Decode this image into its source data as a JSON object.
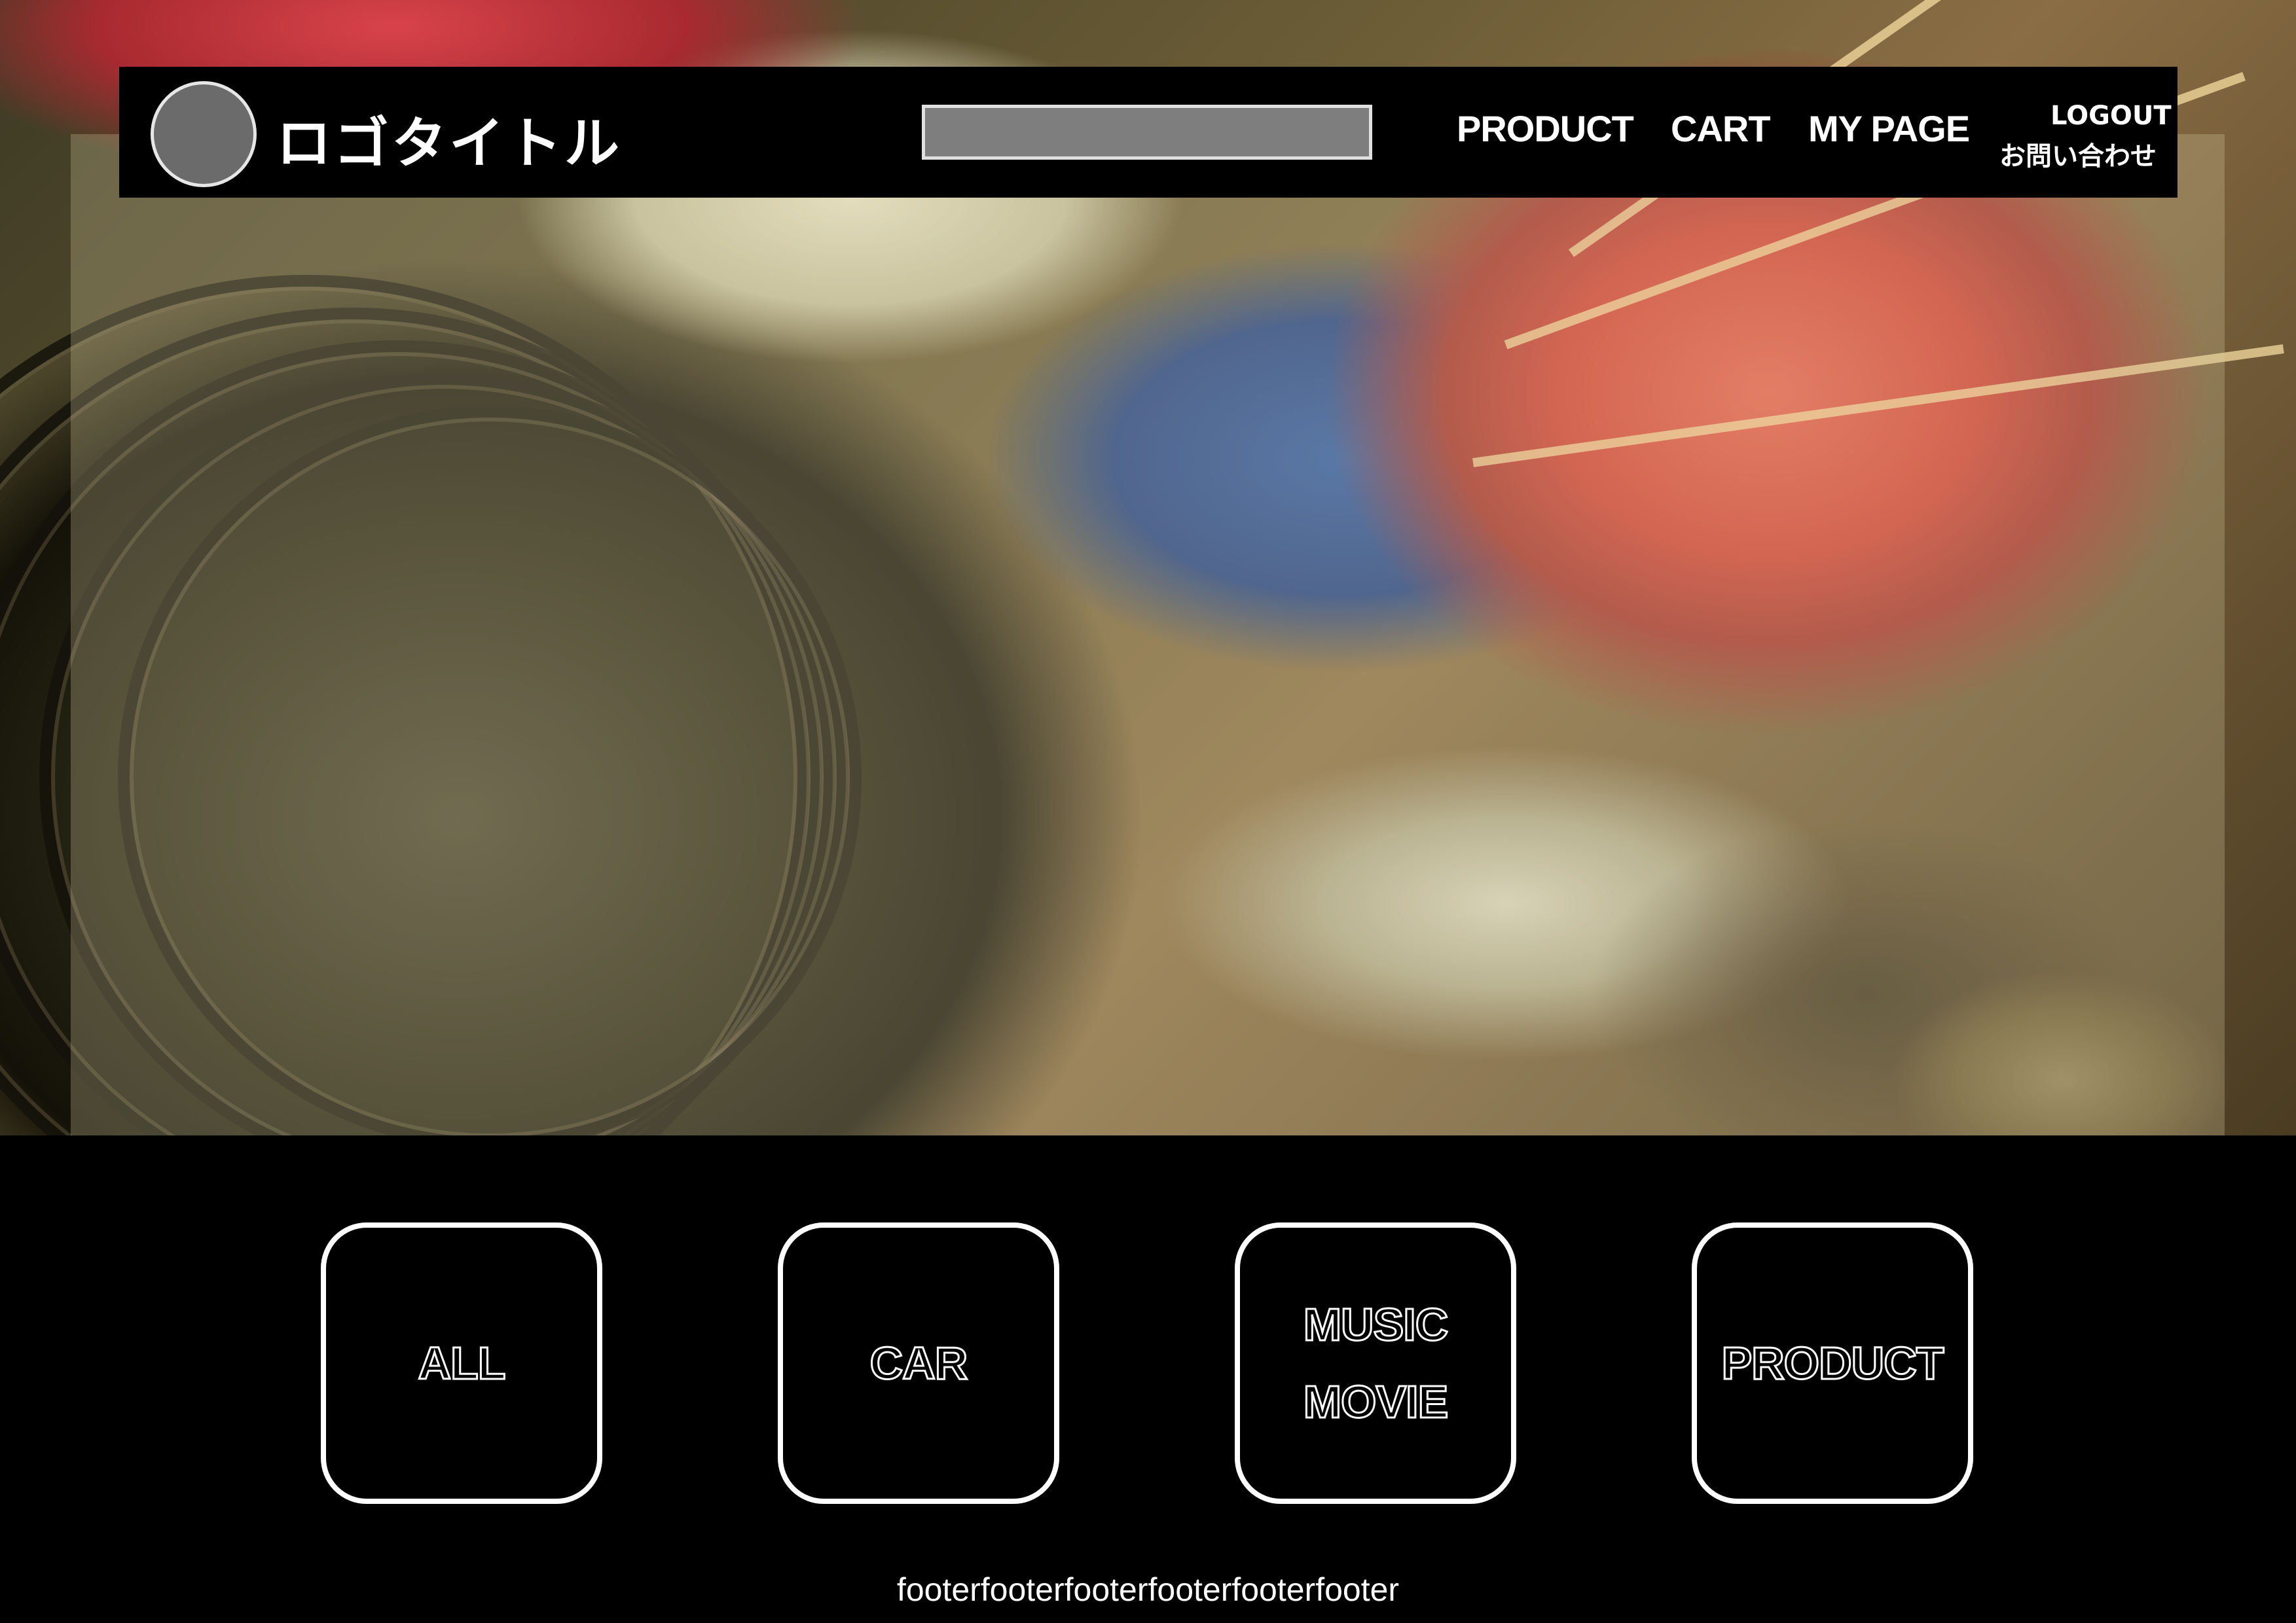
{
  "header": {
    "logo_title": "ロゴタイトル",
    "search_value": "",
    "nav": {
      "product": "PRODUCT",
      "cart": "CART",
      "my_page": "MY PAGE",
      "logout": "LOGOUT",
      "contact": "お問い合わせ"
    }
  },
  "categories": {
    "all": "ALL",
    "car": "CAR",
    "music": "MUSIC",
    "movie": "MOVIE",
    "product": "PRODUCT"
  },
  "footer": {
    "text": "footerfooterfooterfooterfooterfooter"
  },
  "colors": {
    "header_background": "#000000",
    "search_box": "#7e7e7e",
    "logo_circle": "#6b6b6b",
    "tile_border": "#ffffff",
    "page_background": "#000000"
  }
}
